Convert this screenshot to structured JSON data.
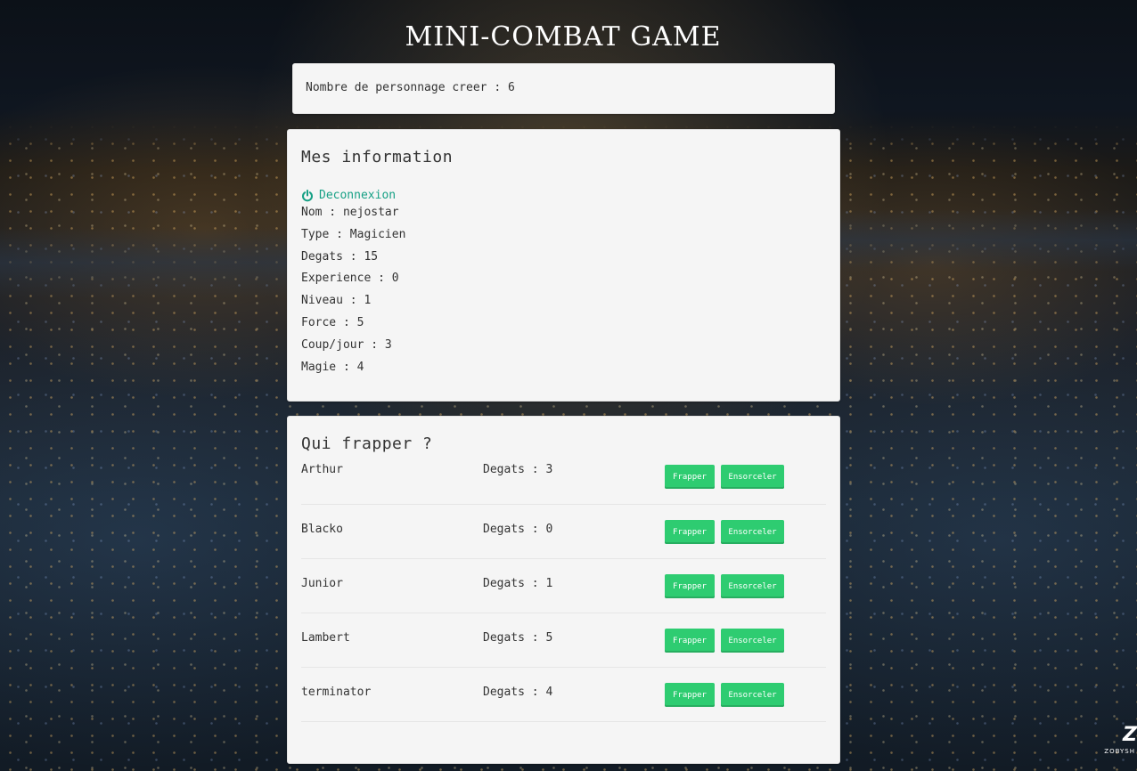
{
  "page": {
    "title": "MINI-COMBAT GAME"
  },
  "counter": {
    "text": "Nombre de personnage creer : 6"
  },
  "info": {
    "heading": "Mes information",
    "logout_label": "Deconnexion",
    "logout_icon": "power-icon",
    "stats": [
      "Nom : nejostar",
      "Type : Magicien",
      "Degats : 15",
      "Experience : 0",
      "Niveau : 1",
      "Force : 5",
      "Coup/jour : 3",
      "Magie : 4"
    ]
  },
  "targets": {
    "heading": "Qui frapper ?",
    "hit_label": "Frapper",
    "spell_label": "Ensorceler",
    "rows": [
      {
        "name": "Arthur",
        "degats": "Degats : 3"
      },
      {
        "name": "Blacko",
        "degats": "Degats : 0"
      },
      {
        "name": "Junior",
        "degats": "Degats : 1"
      },
      {
        "name": "Lambert",
        "degats": "Degats : 5"
      },
      {
        "name": "terminator",
        "degats": "Degats : 4"
      }
    ]
  },
  "watermark": {
    "mark": "Z",
    "sub": "ZOBYSH"
  },
  "colors": {
    "accent_green": "#2ecc71",
    "link_teal": "#16a085",
    "panel_bg": "#f5f5f5"
  }
}
